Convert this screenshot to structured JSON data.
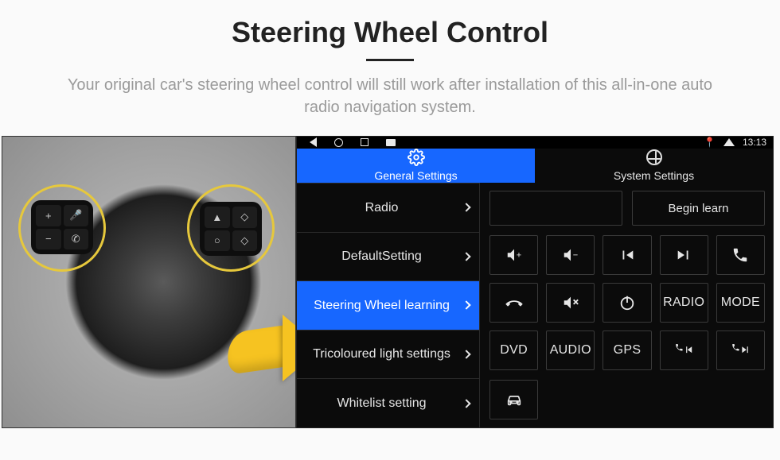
{
  "title": "Steering Wheel Control",
  "subtitle": "Your original car's steering wheel control will still work after installation of this all-in-one auto radio navigation system.",
  "statusbar": {
    "time": "13:13"
  },
  "tabs": {
    "general": "General Settings",
    "system": "System Settings"
  },
  "sidebar": {
    "items": [
      {
        "label": "Radio"
      },
      {
        "label": "DefaultSetting"
      },
      {
        "label": "Steering Wheel learning"
      },
      {
        "label": "Tricoloured light settings"
      },
      {
        "label": "Whitelist setting"
      }
    ]
  },
  "actions": {
    "begin_learn": "Begin learn"
  },
  "buttons": {
    "radio": "RADIO",
    "mode": "MODE",
    "dvd": "DVD",
    "audio": "AUDIO",
    "gps": "GPS"
  }
}
